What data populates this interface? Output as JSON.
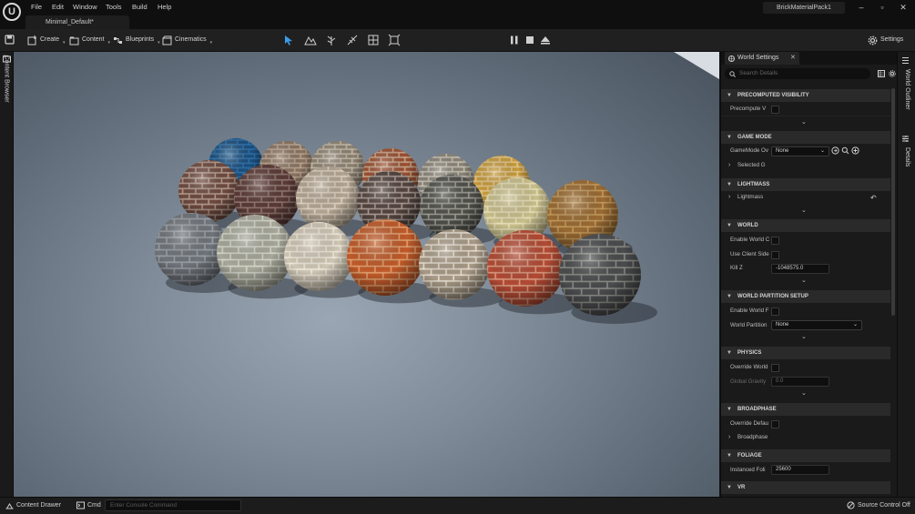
{
  "menu": {
    "file": "File",
    "edit": "Edit",
    "window": "Window",
    "tools": "Tools",
    "build": "Build",
    "help": "Help"
  },
  "project_name": "BrickMaterialPack1",
  "level_tab": "Minimal_Default*",
  "toolbar": {
    "create": "Create",
    "content": "Content",
    "blueprints": "Blueprints",
    "cinematics": "Cinematics",
    "settings": "Settings"
  },
  "left_strip": {
    "content_browser": "Content Browser"
  },
  "right_strip": {
    "world_outliner": "World Outliner",
    "details": "Details"
  },
  "panel": {
    "tab": "World Settings",
    "search_placeholder": "Search Details",
    "sections": {
      "precomputed_visibility": "PRECOMPUTED VISIBILITY",
      "game_mode": "GAME MODE",
      "lightmass": "LIGHTMASS",
      "world": "WORLD",
      "world_partition_setup": "WORLD PARTITION SETUP",
      "physics": "PHYSICS",
      "broadphase": "BROADPHASE",
      "foliage": "FOLIAGE",
      "vr": "VR"
    },
    "rows": {
      "precompute_v": "Precompute V",
      "gamemode_ov": "GameMode Ov",
      "gamemode_value": "None",
      "selected_g": "Selected G",
      "lightmass": "Lightmass",
      "enable_world_c": "Enable World C",
      "use_client_side": "Use Client Side",
      "kill_z": "Kill Z",
      "kill_z_value": "-1048575.0",
      "enable_world_f": "Enable World F",
      "world_partition": "World Partition",
      "world_partition_value": "None",
      "override_world": "Override World",
      "global_gravity": "Global Gravity",
      "global_gravity_value": "0.0",
      "override_defau": "Override Defau",
      "broadphase": "Broadphase",
      "instanced_foli": "Instanced Foli",
      "instanced_foli_value": "25600"
    }
  },
  "statusbar": {
    "content_drawer": "Content Drawer",
    "cmd": "Cmd",
    "console_placeholder": "Enter Console Command",
    "source_control": "Source Control Off"
  },
  "colors": {
    "accent_blue": "#3b9de8",
    "section_bg": "#2a2a2a",
    "panel_bg": "#1a1a1a"
  },
  "viewport": {
    "spheres": [
      {
        "id": "s1",
        "base": "#1c4f7d",
        "mortar": "#2d6fa8"
      },
      {
        "id": "s2",
        "base": "#8a7361",
        "mortar": "#b8a48f"
      },
      {
        "id": "s3",
        "base": "#8d8272",
        "mortar": "#c3b8a6"
      },
      {
        "id": "s4",
        "base": "#9b5032",
        "mortar": "#c9a58a"
      },
      {
        "id": "s5",
        "base": "#8a8478",
        "mortar": "#c8c2b4"
      },
      {
        "id": "s6",
        "base": "#c89b3a",
        "mortar": "#e2c58a"
      },
      {
        "id": "s7",
        "base": "#6e4a40",
        "mortar": "#b39a8c"
      },
      {
        "id": "s8",
        "base": "#5a3a36",
        "mortar": "#8f7570"
      },
      {
        "id": "s9",
        "base": "#b3a592",
        "mortar": "#ddd1c1"
      },
      {
        "id": "s10",
        "base": "#53443f",
        "mortar": "#a89a93"
      },
      {
        "id": "s11",
        "base": "#50504b",
        "mortar": "#9c9c93"
      },
      {
        "id": "s12",
        "base": "#c9bf8c",
        "mortar": "#e8e0b8"
      },
      {
        "id": "s13",
        "base": "#9a6a33",
        "mortar": "#c29a5c"
      },
      {
        "id": "s14",
        "base": "#6f747a",
        "mortar": "#9ba0a6"
      },
      {
        "id": "s15",
        "base": "#a7a89a",
        "mortar": "#d6d7cb"
      },
      {
        "id": "s16",
        "base": "#cfc6b4",
        "mortar": "#efe9dc"
      },
      {
        "id": "s17",
        "base": "#c05a2a",
        "mortar": "#e0a070"
      },
      {
        "id": "s18",
        "base": "#a89a86",
        "mortar": "#e6ded0"
      },
      {
        "id": "s19",
        "base": "#b24a34",
        "mortar": "#d99a80"
      },
      {
        "id": "s20",
        "base": "#4a4b4d",
        "mortar": "#8a8a86"
      }
    ]
  }
}
